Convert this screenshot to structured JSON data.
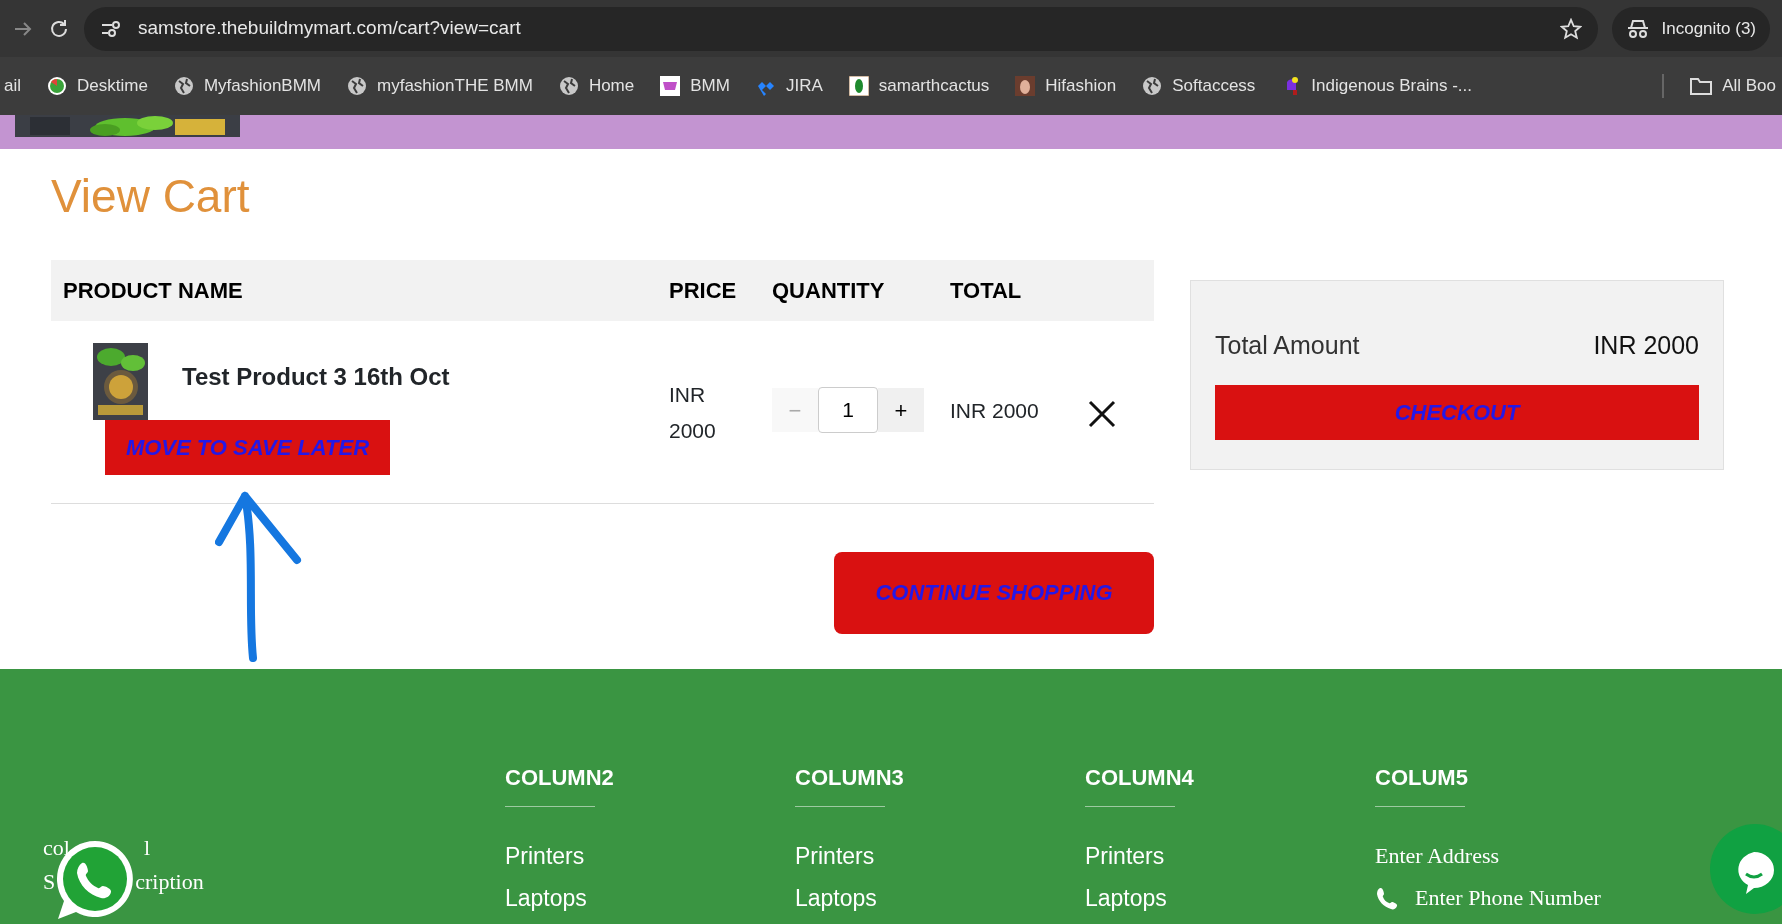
{
  "browser": {
    "url": "samstore.thebuildmymart.com/cart?view=cart",
    "profile": "Incognito (3)"
  },
  "bookmarks": [
    {
      "label": "ail"
    },
    {
      "label": "Desktime"
    },
    {
      "label": "MyfashionBMM"
    },
    {
      "label": "myfashionTHE BMM"
    },
    {
      "label": "Home"
    },
    {
      "label": "BMM"
    },
    {
      "label": "JIRA"
    },
    {
      "label": "samarthcactus"
    },
    {
      "label": "Hifashion"
    },
    {
      "label": "Softaccess"
    },
    {
      "label": "Indigenous Brains -..."
    }
  ],
  "all_bookmarks": "All Boo",
  "page_title": "View Cart",
  "table": {
    "columns": [
      "PRODUCT NAME",
      "PRICE",
      "QUANTITY",
      "TOTAL"
    ],
    "rows": [
      {
        "name": "Test Product 3 16th Oct",
        "save_later": "MOVE TO SAVE LATER",
        "price": "INR 2000",
        "quantity": "1",
        "decrement": "−",
        "decrement_disabled": true,
        "increment": "+",
        "total": "INR 2000"
      }
    ]
  },
  "continue_button": "CONTINUE SHOPPING",
  "summary": {
    "label": "Total Amount",
    "value": "INR 2000",
    "checkout": "CHECKOUT"
  },
  "footer": {
    "column1": [
      [
        "col",
        "l"
      ],
      [
        "S",
        "cription"
      ]
    ],
    "columns": [
      {
        "heading": "COLUMN2",
        "kind": "links",
        "items": [
          "Printers",
          "Laptops"
        ]
      },
      {
        "heading": "COLUMN3",
        "kind": "links",
        "items": [
          "Printers",
          "Laptops"
        ]
      },
      {
        "heading": "COLUMN4",
        "kind": "links",
        "items": [
          "Printers",
          "Laptops"
        ]
      },
      {
        "heading": "COLUM5",
        "kind": "contact",
        "items": [
          "Enter Address",
          "Enter Phone Number"
        ]
      }
    ]
  }
}
